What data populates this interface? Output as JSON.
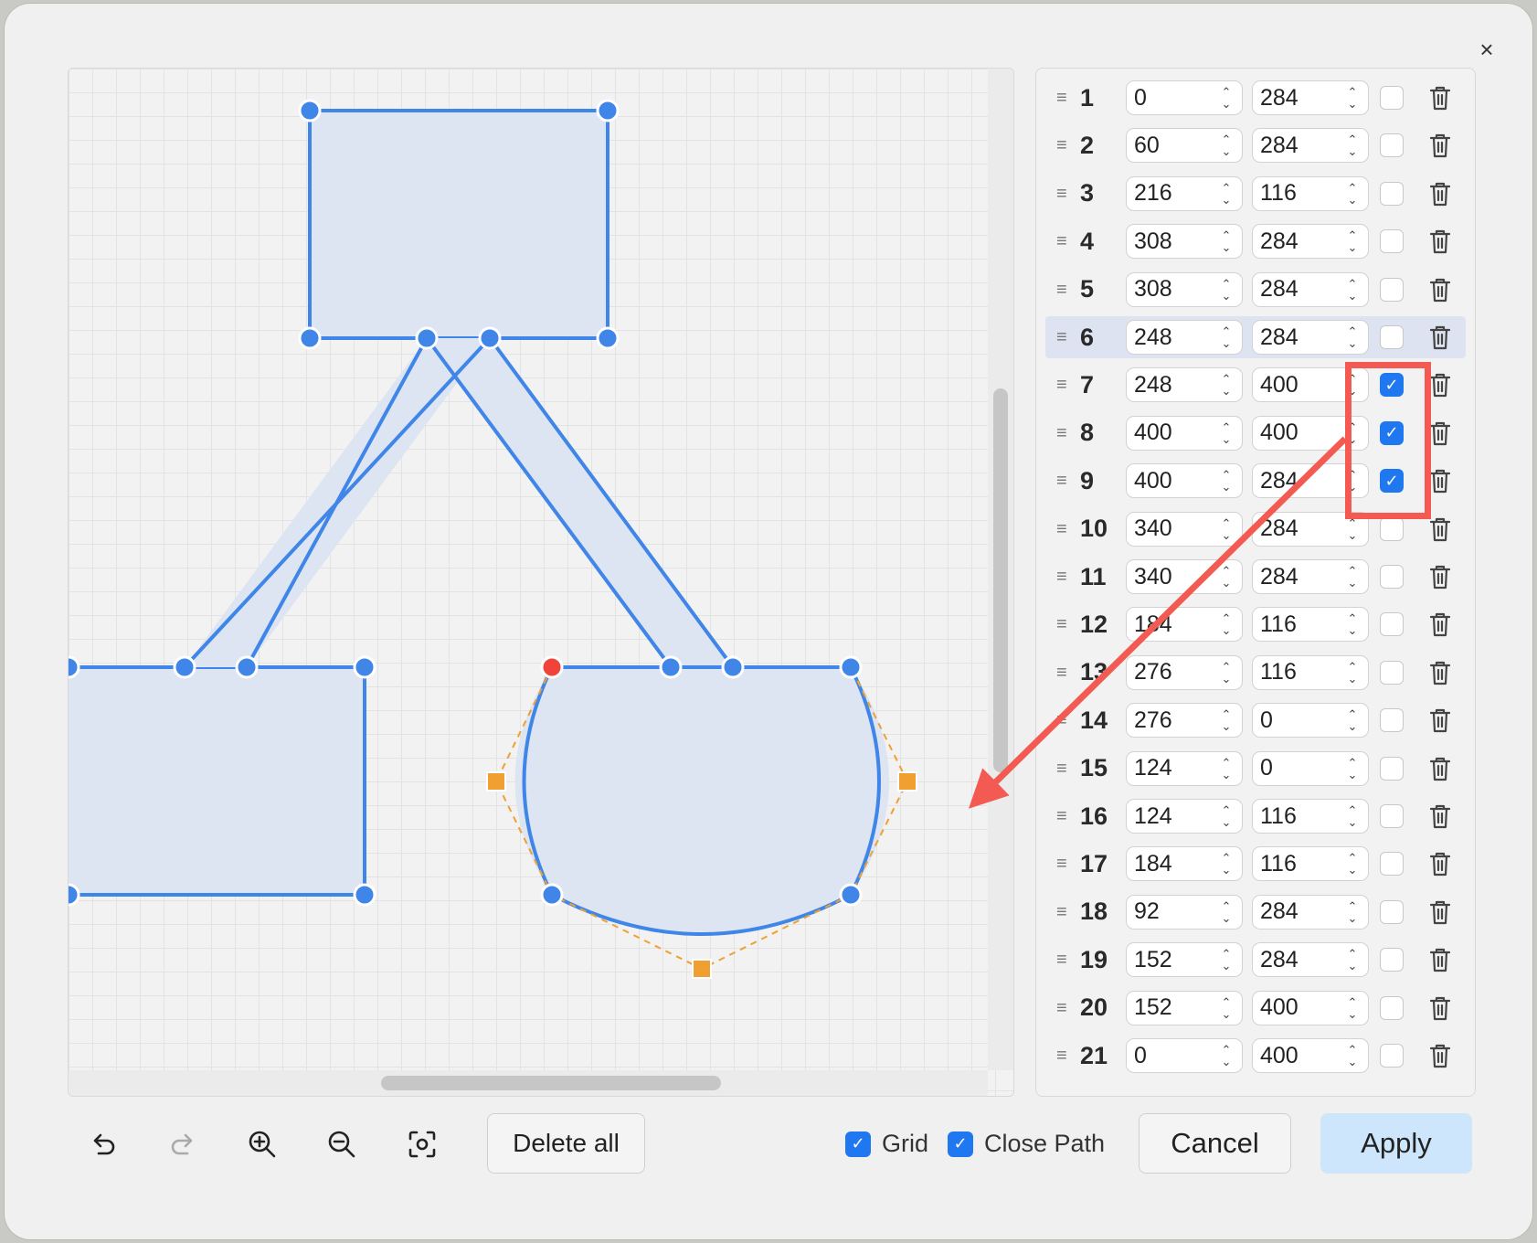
{
  "dialog": {
    "close_label": "×"
  },
  "points": [
    {
      "index": "1",
      "x": "0",
      "y": "284",
      "curve": false
    },
    {
      "index": "2",
      "x": "60",
      "y": "284",
      "curve": false
    },
    {
      "index": "3",
      "x": "216",
      "y": "116",
      "curve": false
    },
    {
      "index": "4",
      "x": "308",
      "y": "284",
      "curve": false
    },
    {
      "index": "5",
      "x": "308",
      "y": "284",
      "curve": false
    },
    {
      "index": "6",
      "x": "248",
      "y": "284",
      "curve": false,
      "selected": true
    },
    {
      "index": "7",
      "x": "248",
      "y": "400",
      "curve": true
    },
    {
      "index": "8",
      "x": "400",
      "y": "400",
      "curve": true
    },
    {
      "index": "9",
      "x": "400",
      "y": "284",
      "curve": true
    },
    {
      "index": "10",
      "x": "340",
      "y": "284",
      "curve": false
    },
    {
      "index": "11",
      "x": "340",
      "y": "284",
      "curve": false
    },
    {
      "index": "12",
      "x": "184",
      "y": "116",
      "curve": false
    },
    {
      "index": "13",
      "x": "276",
      "y": "116",
      "curve": false
    },
    {
      "index": "14",
      "x": "276",
      "y": "0",
      "curve": false
    },
    {
      "index": "15",
      "x": "124",
      "y": "0",
      "curve": false
    },
    {
      "index": "16",
      "x": "124",
      "y": "116",
      "curve": false
    },
    {
      "index": "17",
      "x": "184",
      "y": "116",
      "curve": false
    },
    {
      "index": "18",
      "x": "92",
      "y": "284",
      "curve": false
    },
    {
      "index": "19",
      "x": "152",
      "y": "284",
      "curve": false
    },
    {
      "index": "20",
      "x": "152",
      "y": "400",
      "curve": false
    },
    {
      "index": "21",
      "x": "0",
      "y": "400",
      "curve": false
    }
  ],
  "toolbar": {
    "undo_icon": "undo-icon",
    "redo_icon": "redo-icon",
    "zoom_in_icon": "zoom-in-icon",
    "zoom_out_icon": "zoom-out-icon",
    "fit_icon": "fit-view-icon",
    "delete_all_label": "Delete all",
    "grid_label": "Grid",
    "grid_checked": true,
    "close_path_label": "Close Path",
    "close_path_checked": true,
    "cancel_label": "Cancel",
    "apply_label": "Apply"
  },
  "colors": {
    "shape_stroke": "#3f86e8",
    "shape_fill": "#dde4f2",
    "start_point": "#f0433a",
    "control_point": "#f0a030",
    "annotation": "#f25a52",
    "checkbox_on": "#1f78f0",
    "apply_bg": "#cde6fb"
  }
}
